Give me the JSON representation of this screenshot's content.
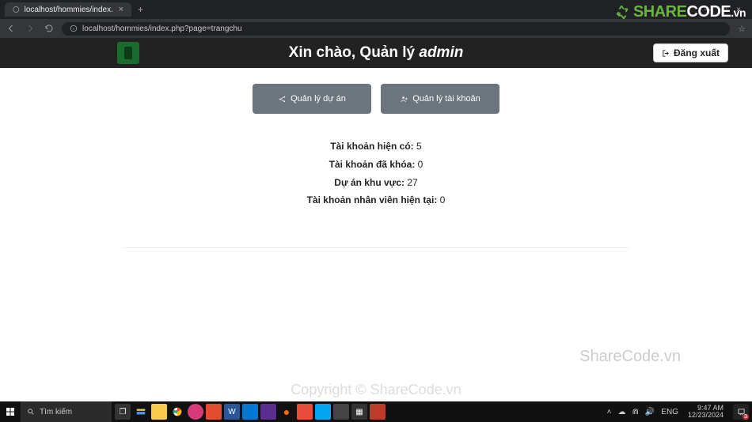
{
  "browser": {
    "tab_title": "localhost/hommies/index.php",
    "url": "localhost/hommies/index.php?page=trangchu",
    "new_tab": "+"
  },
  "watermark": {
    "logo_text_1": "SHARE",
    "logo_text_2": "CODE",
    "logo_text_3": ".vn",
    "text1": "ShareCode.vn",
    "text2": "Copyright © ShareCode.vn"
  },
  "header": {
    "greeting_prefix": "Xin chào, Quản lý ",
    "greeting_user": "admin",
    "logout": "Đăng xuất"
  },
  "buttons": {
    "manage_projects": "Quản lý dự án",
    "manage_accounts": "Quản lý tài khoản"
  },
  "stats": {
    "row1_label": "Tài khoản hiện có:",
    "row1_value": "5",
    "row2_label": "Tài khoản đã khóa:",
    "row2_value": "0",
    "row3_label": "Dự án khu vực:",
    "row3_value": "27",
    "row4_label": "Tài khoản nhân viên hiện tại:",
    "row4_value": "0"
  },
  "taskbar": {
    "search_placeholder": "Tìm kiếm",
    "tray_lang": "ENG",
    "time": "9:47 AM",
    "date": "12/23/2024",
    "notif_count": "3"
  }
}
